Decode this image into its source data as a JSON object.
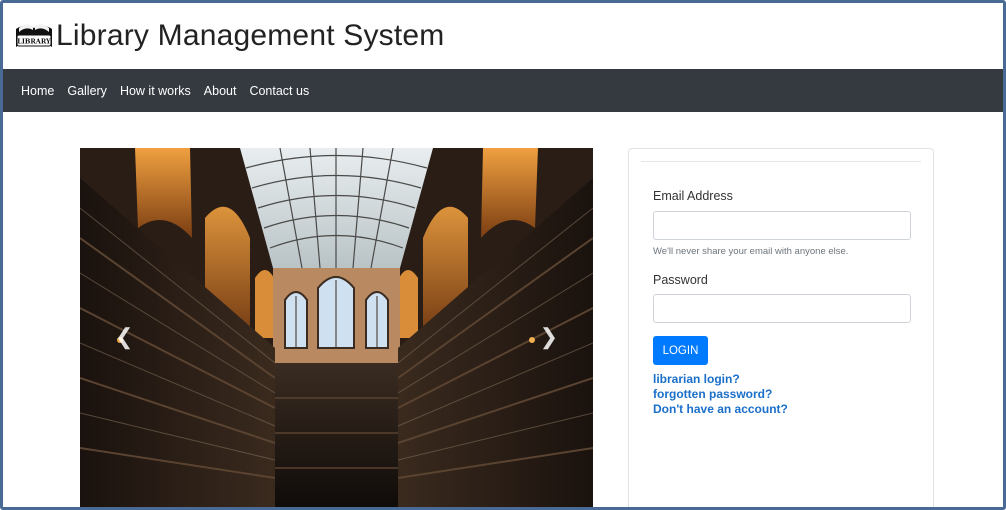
{
  "header": {
    "logo_text": "LIBRARY",
    "title": "Library Management System"
  },
  "nav": {
    "items": [
      "Home",
      "Gallery",
      "How it works",
      "About",
      "Contact us"
    ]
  },
  "carousel": {
    "prev_icon": "chevron-left-icon",
    "next_icon": "chevron-right-icon",
    "prev_glyph": "❮",
    "next_glyph": "❯"
  },
  "login_form": {
    "email_label": "Email Address",
    "email_value": "",
    "email_help": "We'll never share your email with anyone else.",
    "password_label": "Password",
    "password_value": "",
    "login_button": "LOGIN",
    "links": [
      "librarian login?",
      "forgotten password?",
      "Don't have an account?"
    ]
  },
  "colors": {
    "navbar": "#343a40",
    "primary": "#007bff",
    "link": "#1a6fc9",
    "frame": "#4a6a96"
  }
}
